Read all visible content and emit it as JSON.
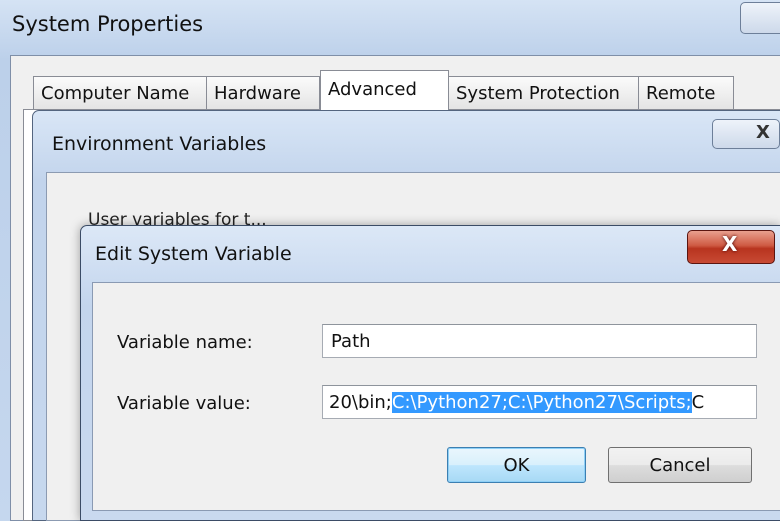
{
  "system_properties": {
    "title": "System Properties",
    "tabs": [
      "Computer Name",
      "Hardware",
      "Advanced",
      "System Protection",
      "Remote"
    ],
    "active_tab": "Advanced"
  },
  "environment_variables": {
    "title": "Environment Variables",
    "close_glyph": "X",
    "user_variables_label": "User variables for t..."
  },
  "edit_dialog": {
    "title": "Edit System Variable",
    "close_glyph": "X",
    "variable_name_label": "Variable name:",
    "variable_name_value": "Path",
    "variable_value_label": "Variable value:",
    "variable_value_unselected": "20\\bin;",
    "variable_value_selected": "C:\\Python27;C:\\Python27\\Scripts;",
    "variable_value_tail": "C",
    "ok_label": "OK",
    "cancel_label": "Cancel"
  },
  "colors": {
    "selection": "#3399ff",
    "close_red": "#c84a34"
  }
}
